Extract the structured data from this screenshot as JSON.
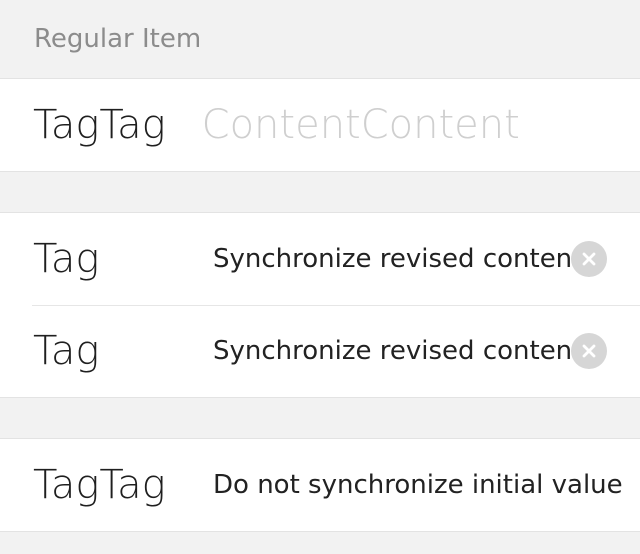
{
  "section": {
    "header": "Regular Item"
  },
  "group1": {
    "row1": {
      "tag": "TagTag",
      "placeholder": "ContentContent"
    }
  },
  "group2": {
    "row1": {
      "tag": "Tag",
      "value": "Synchronize revised content",
      "clear_icon": "clear-icon"
    },
    "row2": {
      "tag": "Tag",
      "value": "Synchronize revised content",
      "clear_icon": "clear-icon"
    }
  },
  "group3": {
    "row1": {
      "tag": "TagTag",
      "value": "Do not synchronize initial value"
    }
  }
}
